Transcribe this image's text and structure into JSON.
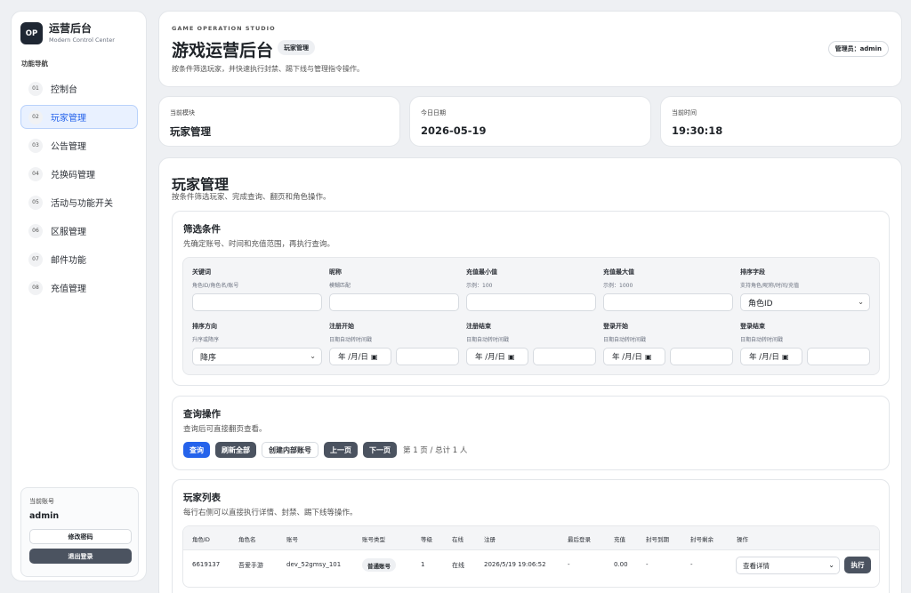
{
  "sidebar": {
    "logo": "OP",
    "title": "运营后台",
    "subtitle": "Modern Control Center",
    "nav_caption": "功能导航",
    "items": [
      {
        "num": "01",
        "label": "控制台"
      },
      {
        "num": "02",
        "label": "玩家管理"
      },
      {
        "num": "03",
        "label": "公告管理"
      },
      {
        "num": "04",
        "label": "兑换码管理"
      },
      {
        "num": "05",
        "label": "活动与功能开关"
      },
      {
        "num": "06",
        "label": "区服管理"
      },
      {
        "num": "07",
        "label": "邮件功能"
      },
      {
        "num": "08",
        "label": "充值管理"
      }
    ],
    "account_caption": "当前账号",
    "account_name": "admin",
    "change_password": "修改密码",
    "logout": "退出登录"
  },
  "header": {
    "eyebrow": "GAME OPERATION STUDIO",
    "title": "游戏运营后台",
    "badge": "玩家管理",
    "description": "按条件筛选玩家，并快速执行封禁、踢下线与管理指令操作。",
    "admin": "管理员：admin"
  },
  "stats": [
    {
      "label": "当前模块",
      "value": "玩家管理"
    },
    {
      "label": "今日日期",
      "value": "2026-05-19"
    },
    {
      "label": "当前时间",
      "value": "19:30:18"
    }
  ],
  "main": {
    "title": "玩家管理",
    "description": "按条件筛选玩家、完成查询、翻页和角色操作。"
  },
  "filter": {
    "title": "筛选条件",
    "description": "先确定账号、时间和充值范围，再执行查询。",
    "keyword": {
      "label": "关键词",
      "hint": "角色ID/角色名/账号",
      "value": ""
    },
    "nickname": {
      "label": "昵称",
      "hint": "模糊匹配",
      "value": ""
    },
    "recharge_min": {
      "label": "充值最小值",
      "hint": "示例：100",
      "value": ""
    },
    "recharge_max": {
      "label": "充值最大值",
      "hint": "示例：1000",
      "value": ""
    },
    "sort_field": {
      "label": "排序字段",
      "hint": "支持角色/昵称/时间/充值",
      "value": "角色ID"
    },
    "sort_dir": {
      "label": "排序方向",
      "hint": "升序或降序",
      "value": "降序"
    },
    "reg_start": {
      "label": "注册开始",
      "hint": "日期自动转时间戳",
      "date": "年 /月/日"
    },
    "reg_end": {
      "label": "注册结束",
      "hint": "日期自动转时间戳",
      "date": "年 /月/日"
    },
    "login_start": {
      "label": "登录开始",
      "hint": "日期自动转时间戳",
      "date": "年 /月/日"
    },
    "login_end": {
      "label": "登录结束",
      "hint": "日期自动转时间戳",
      "date": "年 /月/日"
    }
  },
  "query": {
    "title": "查询操作",
    "description": "查询后可直接翻页查看。",
    "search": "查询",
    "refresh_all": "刷新全部",
    "create_internal": "创建内部账号",
    "prev": "上一页",
    "next": "下一页",
    "page_info": "第 1 页 / 总计 1 人"
  },
  "players": {
    "title": "玩家列表",
    "description": "每行右侧可以直接执行详情、封禁、踢下线等操作。",
    "columns": [
      "角色ID",
      "角色名",
      "账号",
      "账号类型",
      "等级",
      "在线",
      "注册",
      "最后登录",
      "充值",
      "封号到期",
      "封号剩余",
      "操作"
    ],
    "rows": [
      {
        "id": "6619137",
        "name": "吾爱手游",
        "account": "dev_52gmsy_101",
        "type": "普通账号",
        "level": "1",
        "online": "在线",
        "registered": "2026/5/19 19:06:52",
        "last_login": "-",
        "recharge": "0.00",
        "ban_expire": "-",
        "ban_remaining": "-",
        "action": "查看详情",
        "execute": "执行"
      }
    ]
  },
  "colors": {
    "accent": "#2563eb",
    "dark_button": "#4b5360",
    "background": "#eef0f3"
  }
}
